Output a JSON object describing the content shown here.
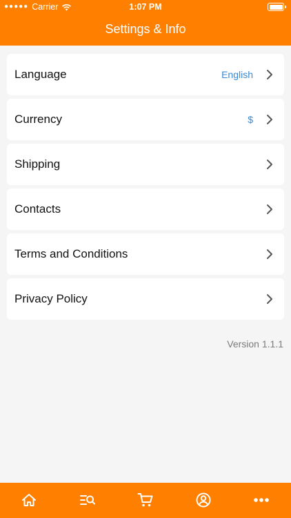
{
  "status_bar": {
    "carrier": "Carrier",
    "time": "1:07 PM"
  },
  "header": {
    "title": "Settings & Info"
  },
  "settings": {
    "items": [
      {
        "label": "Language",
        "value": "English"
      },
      {
        "label": "Currency",
        "value": "$"
      },
      {
        "label": "Shipping",
        "value": ""
      },
      {
        "label": "Contacts",
        "value": ""
      },
      {
        "label": "Terms and Conditions",
        "value": ""
      },
      {
        "label": "Privacy Policy",
        "value": ""
      }
    ]
  },
  "footer": {
    "version": "Version 1.1.1"
  },
  "tabbar": {
    "items": [
      {
        "icon": "home-icon"
      },
      {
        "icon": "search-list-icon"
      },
      {
        "icon": "cart-icon"
      },
      {
        "icon": "account-icon"
      },
      {
        "icon": "more-icon"
      }
    ]
  },
  "colors": {
    "accent": "#ff8000",
    "link": "#3a87d6",
    "background": "#f5f5f5"
  }
}
